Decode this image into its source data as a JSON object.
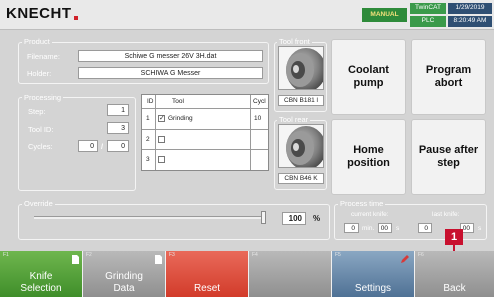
{
  "header": {
    "logo": "KNECHT",
    "mode": "MANUAL",
    "twincat": "TwinCAT",
    "plc": "PLC",
    "date": "1/29/2019",
    "time": "8:20:49 AM",
    "colors": {
      "mode_bg": "#2e8b3a",
      "status_bg": "#3a9a4a",
      "datetime_bg": "#2f4f73"
    }
  },
  "product": {
    "legend": "Product",
    "filename_label": "Filename:",
    "filename_value": "Schiwe G messer 26V  3H.dat",
    "holder_label": "Holder:",
    "holder_value": "SCHIWA G Messer"
  },
  "processing": {
    "legend": "Processing",
    "step_label": "Step:",
    "step_value": "1",
    "toolid_label": "Tool ID:",
    "toolid_value": "3",
    "cycles_label": "Cycles:",
    "cycles_current": "0",
    "cycles_sep": "/",
    "cycles_total": "0"
  },
  "table": {
    "headers": [
      "ID",
      "Tool",
      "Cycl"
    ],
    "rows": [
      {
        "id": "1",
        "checked": true,
        "check_mark": "✓",
        "tool": "Grinding",
        "cycles": "10"
      },
      {
        "id": "2",
        "checked": false,
        "check_mark": "",
        "tool": "",
        "cycles": ""
      },
      {
        "id": "3",
        "checked": false,
        "check_mark": "",
        "tool": "",
        "cycles": ""
      }
    ]
  },
  "tool_front": {
    "legend": "Tool front",
    "name": "CBN B181 l"
  },
  "tool_rear": {
    "legend": "Tool rear",
    "name": "CBN B46 K"
  },
  "buttons": {
    "coolant": "Coolant\npump",
    "abort": "Program\nabort",
    "home": "Home\nposition",
    "pause": "Pause after\nstep"
  },
  "override": {
    "legend": "Override",
    "value": "100",
    "unit": "%",
    "level_percent": 100
  },
  "process_time": {
    "legend": "Process time",
    "current_label": "current knife:",
    "last_label": "last knife:",
    "current_min": "0",
    "current_sec": "00",
    "last_min": "0",
    "last_sec": "00",
    "min_unit": "min.",
    "sec_unit": "s"
  },
  "callout": {
    "number": "1",
    "color": "#c8102e"
  },
  "fkeys": [
    {
      "num": "F1",
      "label": "Knife\nSelection",
      "color": "green"
    },
    {
      "num": "F2",
      "label": "Grinding\nData",
      "color": "gray"
    },
    {
      "num": "F3",
      "label": "Reset",
      "color": "red"
    },
    {
      "num": "F4",
      "label": "",
      "color": "gray"
    },
    {
      "num": "F5",
      "label": "Settings",
      "color": "blue"
    },
    {
      "num": "F6",
      "label": "Back",
      "color": "gray"
    }
  ]
}
